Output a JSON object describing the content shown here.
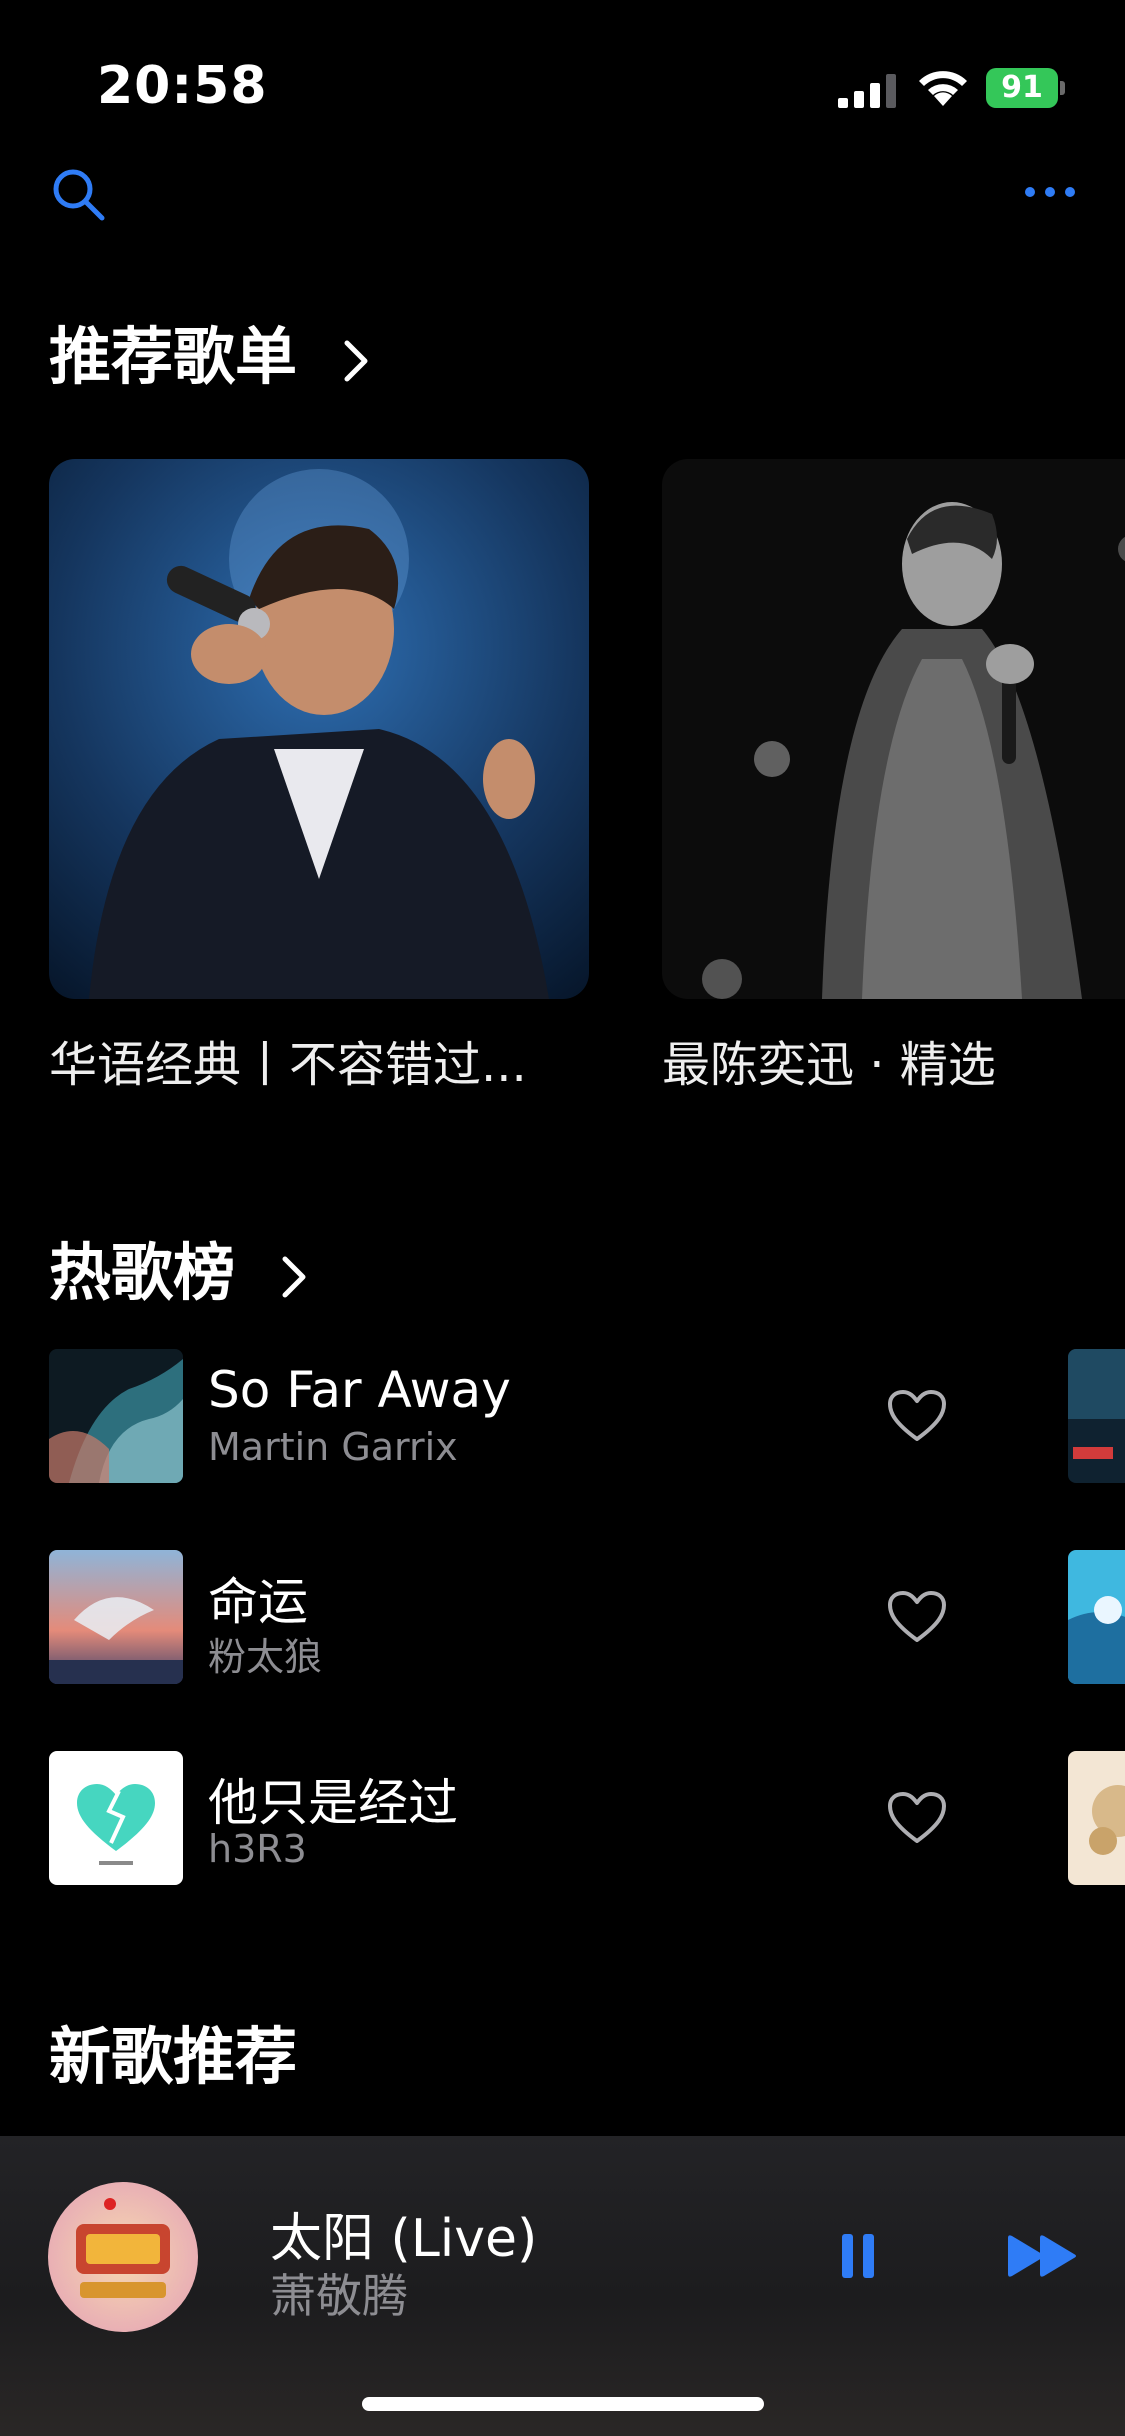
{
  "status_bar": {
    "time": "20:58",
    "battery": "91"
  },
  "colors": {
    "accent": "#2f7cf6",
    "battery": "#34c759",
    "secondary_text": "#8d8d92"
  },
  "nav": {
    "search_icon": "search-icon",
    "more_icon": "ellipsis-icon"
  },
  "sections": {
    "recommended": {
      "title": "推荐歌单"
    },
    "hot_chart": {
      "title": "热歌榜"
    },
    "new_songs": {
      "title": "新歌推荐"
    }
  },
  "playlists": [
    {
      "title": "华语经典丨不容错过..."
    },
    {
      "title": "最陈奕迅 · 精选"
    }
  ],
  "hot_songs": [
    {
      "title": "So Far Away",
      "artist": "Martin Garrix"
    },
    {
      "title": "命运",
      "artist": "粉太狼"
    },
    {
      "title": "他只是经过",
      "artist": "h3R3"
    }
  ],
  "now_playing": {
    "title": "太阳 (Live)",
    "artist": "萧敬腾"
  }
}
